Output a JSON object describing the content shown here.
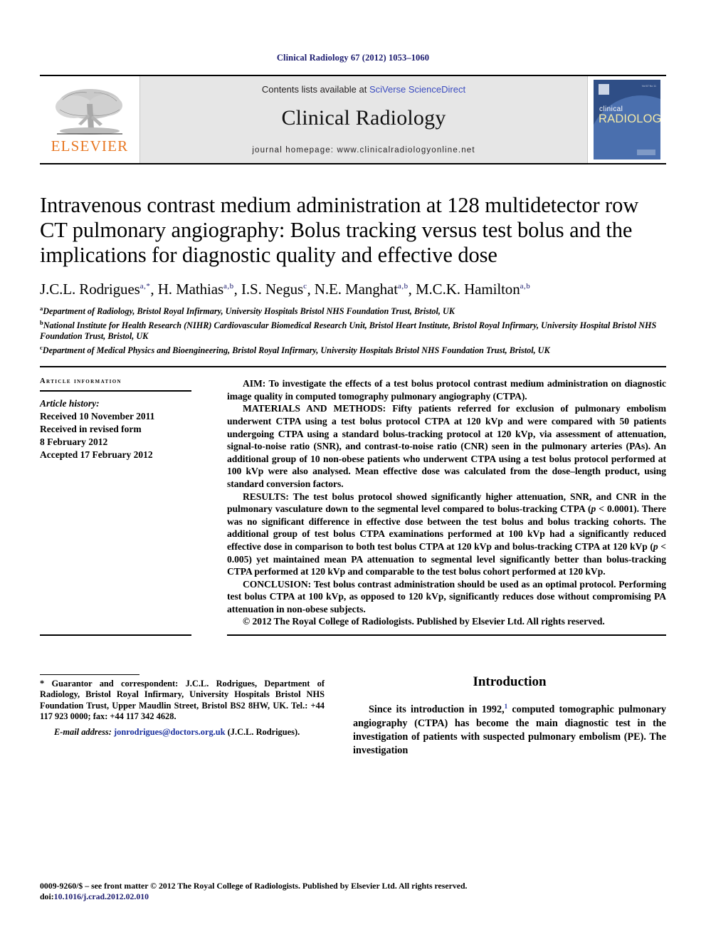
{
  "running_head": "Clinical Radiology 67 (2012) 1053–1060",
  "masthead": {
    "publisher_logo_text": "ELSEVIER",
    "publisher_logo_icon": "elsevier-tree-logo",
    "contents_prefix": "Contents lists available at ",
    "contents_link": "SciVerse ScienceDirect",
    "journal_name": "Clinical Radiology",
    "homepage": "journal homepage: www.clinicalradiologyonline.net",
    "cover": {
      "line1": "clinical",
      "line2": "RADIOLOGY",
      "issue_mark": "Vol 67 No 11",
      "bg_color": "#2f4e86",
      "accent_color": "#f3e9a8"
    }
  },
  "article": {
    "title": "Intravenous contrast medium administration at 128 multidetector row CT pulmonary angiography: Bolus tracking versus test bolus and the implications for diagnostic quality and effective dose",
    "authors": [
      {
        "name": "J.C.L. Rodrigues",
        "marks": "a,*"
      },
      {
        "name": "H. Mathias",
        "marks": "a,b"
      },
      {
        "name": "I.S. Negus",
        "marks": "c"
      },
      {
        "name": "N.E. Manghat",
        "marks": "a,b"
      },
      {
        "name": "M.C.K. Hamilton",
        "marks": "a,b"
      }
    ],
    "affiliations": [
      {
        "mark": "a",
        "text": "Department of Radiology, Bristol Royal Infirmary, University Hospitals Bristol NHS Foundation Trust, Bristol, UK"
      },
      {
        "mark": "b",
        "text": "National Institute for Health Research (NIHR) Cardiovascular Biomedical Research Unit, Bristol Heart Institute, Bristol Royal Infirmary, University Hospital Bristol NHS Foundation Trust, Bristol, UK"
      },
      {
        "mark": "c",
        "text": "Department of Medical Physics and Bioengineering, Bristol Royal Infirmary, University Hospitals Bristol NHS Foundation Trust, Bristol, UK"
      }
    ]
  },
  "article_info": {
    "heading": "ARTICLE INFORMATION",
    "history_label": "Article history:",
    "history": [
      "Received 10 November 2011",
      "Received in revised form",
      "8 February 2012",
      "Accepted 17 February 2012"
    ]
  },
  "abstract": {
    "aim_label": "AIM:",
    "aim_text": " To investigate the effects of a test bolus protocol contrast medium administration on diagnostic image quality in computed tomography pulmonary angiography (CTPA).",
    "methods_label": "MATERIALS AND METHODS:",
    "methods_text": " Fifty patients referred for exclusion of pulmonary embolism underwent CTPA using a test bolus protocol CTPA at 120 kVp and were compared with 50 patients undergoing CTPA using a standard bolus-tracking protocol at 120 kVp, via assessment of attenuation, signal-to-noise ratio (SNR), and contrast-to-noise ratio (CNR) seen in the pulmonary arteries (PAs). An additional group of 10 non-obese patients who underwent CTPA using a test bolus protocol performed at 100 kVp were also analysed. Mean effective dose was calculated from the dose–length product, using standard conversion factors.",
    "results_label": "RESULTS:",
    "results_text_1": " The test bolus protocol showed significantly higher attenuation, SNR, and CNR in the pulmonary vasculature down to the segmental level compared to bolus-tracking CTPA (",
    "results_p1": "p",
    "results_text_2": " < 0.0001). There was no significant difference in effective dose between the test bolus and bolus tracking cohorts. The additional group of test bolus CTPA examinations performed at 100 kVp had a significantly reduced effective dose in comparison to both test bolus CTPA at 120 kVp and bolus-tracking CTPA at 120 kVp (",
    "results_p2": "p",
    "results_text_3": " < 0.005) yet maintained mean PA attenuation to segmental level significantly better than bolus-tracking CTPA performed at 120 kVp and comparable to the test bolus cohort performed at 120 kVp.",
    "conclusion_label": "CONCLUSION:",
    "conclusion_text": " Test bolus contrast administration should be used as an optimal protocol. Performing test bolus CTPA at 100 kVp, as opposed to 120 kVp, significantly reduces dose without compromising PA attenuation in non-obese subjects.",
    "copyright": "© 2012 The Royal College of Radiologists. Published by Elsevier Ltd. All rights reserved."
  },
  "footnote": {
    "text": "* Guarantor and correspondent: J.C.L. Rodrigues, Department of Radiology, Bristol Royal Infirmary, University Hospitals Bristol NHS Foundation Trust, Upper Maudlin Street, Bristol BS2 8HW, UK. Tel.: +44 117 923 0000; fax: +44 117 342 4628.",
    "email_label": "E-mail address:",
    "email": "jonrodrigues@doctors.org.uk",
    "email_owner": "(J.C.L. Rodrigues)."
  },
  "intro": {
    "heading": "Introduction",
    "paragraph_1": "Since its introduction in 1992,",
    "ref_1": "1",
    "paragraph_1b": " computed tomographic pulmonary angiography (CTPA) has become the main diagnostic test in the investigation of patients with suspected pulmonary embolism (PE). The investigation"
  },
  "page_footer": {
    "line1": "0009-9260/$ – see front matter © 2012 The Royal College of Radiologists. Published by Elsevier Ltd. All rights reserved.",
    "doi_label": "doi:",
    "doi_value": "10.1016/j.crad.2012.02.010"
  }
}
